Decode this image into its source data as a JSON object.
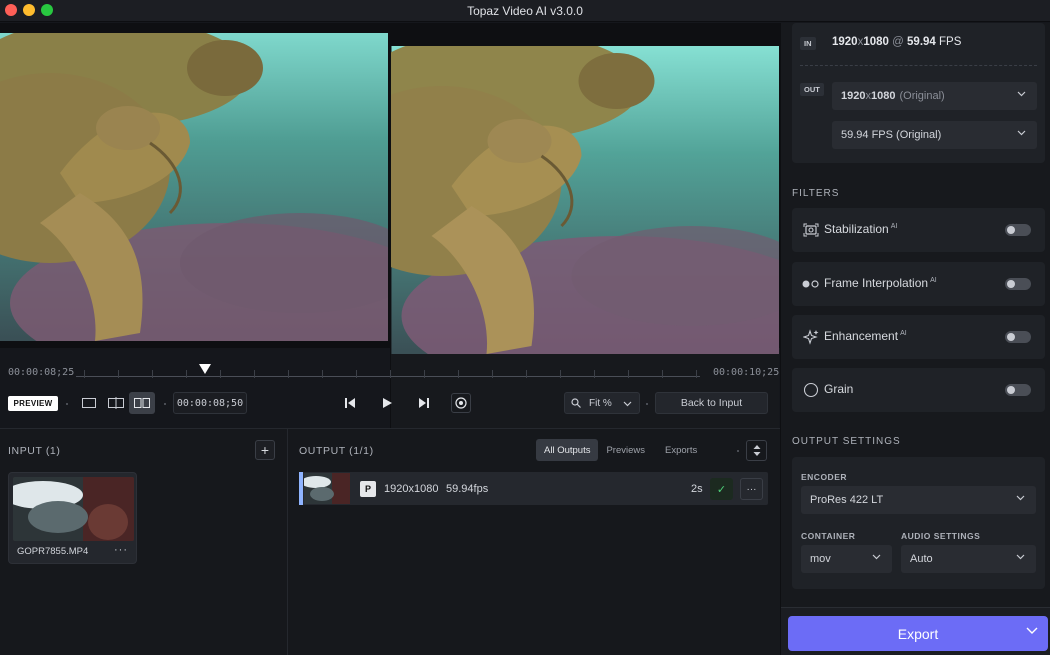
{
  "window": {
    "title": "Topaz Video AI  v3.0.0"
  },
  "timeline": {
    "start_time": "00:00:08;25",
    "end_time": "00:00:10;25",
    "current_timecode": "00:00:08;50"
  },
  "controls": {
    "preview_label": "PREVIEW",
    "zoom_label": "Fit %",
    "back_to_input_label": "Back to Input"
  },
  "input_panel": {
    "title": "INPUT (1)",
    "add_label": "+",
    "files": [
      {
        "name": "GOPR7855.MP4",
        "more": "···"
      }
    ]
  },
  "output_panel": {
    "title": "OUTPUT (1/1)",
    "tabs": [
      "All Outputs",
      "Previews",
      "Exports"
    ],
    "active_tab": "All Outputs",
    "rows": [
      {
        "badge": "P",
        "resolution": "1920x1080",
        "fps": "59.94fps",
        "duration": "2s",
        "check": "✓",
        "more": "···"
      }
    ]
  },
  "io": {
    "in_tag": "IN",
    "in_res_w": "1920",
    "in_res_x": "x",
    "in_res_h": "1080",
    "in_at": "@",
    "in_fps": "59.94",
    "in_fps_unit": "FPS",
    "out_tag": "OUT",
    "out_res": "1920",
    "out_res_x": "x",
    "out_res_h": "1080",
    "out_res_note": "(Original)",
    "out_fps": "59.94 FPS (Original)"
  },
  "filters": {
    "title": "FILTERS",
    "items": [
      {
        "label": "Stabilization",
        "ai": "AI",
        "icon": "stabilization-icon",
        "enabled": false
      },
      {
        "label": "Frame Interpolation",
        "ai": "AI",
        "icon": "frame-interpolation-icon",
        "enabled": false
      },
      {
        "label": "Enhancement",
        "ai": "AI",
        "icon": "sparkle-icon",
        "enabled": false
      },
      {
        "label": "Grain",
        "ai": "",
        "icon": "grain-icon",
        "enabled": false
      }
    ]
  },
  "output_settings": {
    "title": "OUTPUT SETTINGS",
    "encoder_label": "ENCODER",
    "encoder_value": "ProRes 422 LT",
    "container_label": "CONTAINER",
    "container_value": "mov",
    "audio_label": "AUDIO SETTINGS",
    "audio_value": "Auto"
  },
  "export": {
    "label": "Export"
  },
  "colors": {
    "accent": "#6c6cf6",
    "success": "#4fd27a",
    "panel": "#1f2227",
    "background": "#15171c"
  }
}
